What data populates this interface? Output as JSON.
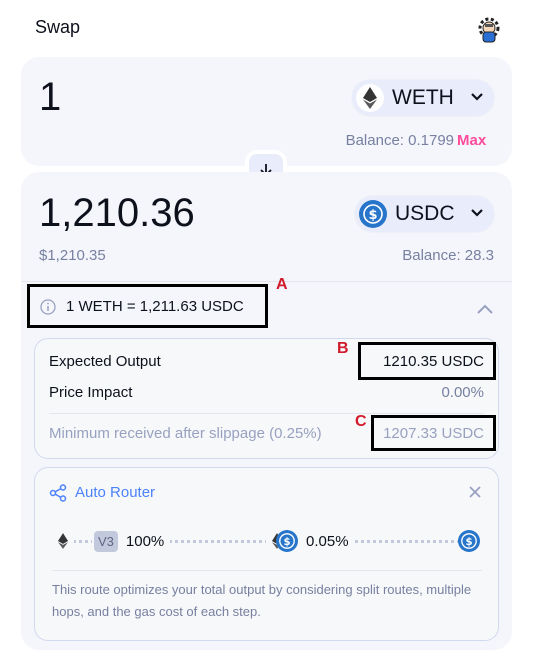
{
  "header": {
    "title": "Swap",
    "settings_icon": "gear-avatar-icon"
  },
  "input": {
    "amount": "1",
    "token": "WETH",
    "balance": "Balance: 0.1799",
    "max_label": "Max"
  },
  "output": {
    "amount": "1,210.36",
    "token": "USDC",
    "usd_value": "$1,210.35",
    "balance": "Balance: 28.3"
  },
  "rate": {
    "text": "1 WETH = 1,211.63 USDC"
  },
  "details": {
    "expected_output_label": "Expected Output",
    "expected_output_value": "1210.35 USDC",
    "price_impact_label": "Price Impact",
    "price_impact_value": "0.00%",
    "min_received_label": "Minimum received after slippage (0.25%)",
    "min_received_value": "1207.33 USDC"
  },
  "router": {
    "title": "Auto Router",
    "version_badge": "V3",
    "split_percent": "100%",
    "fee_tier": "0.05%",
    "description": "This route optimizes your total output by considering split routes, multiple hops, and the gas cost of each step."
  },
  "annotations": {
    "a": "A",
    "b": "B",
    "c": "C"
  },
  "colors": {
    "accent_blue": "#4c82fb",
    "max_pink": "#fc4c9b",
    "usdc_blue": "#2775ca",
    "annotation_red": "#d11a2a"
  }
}
